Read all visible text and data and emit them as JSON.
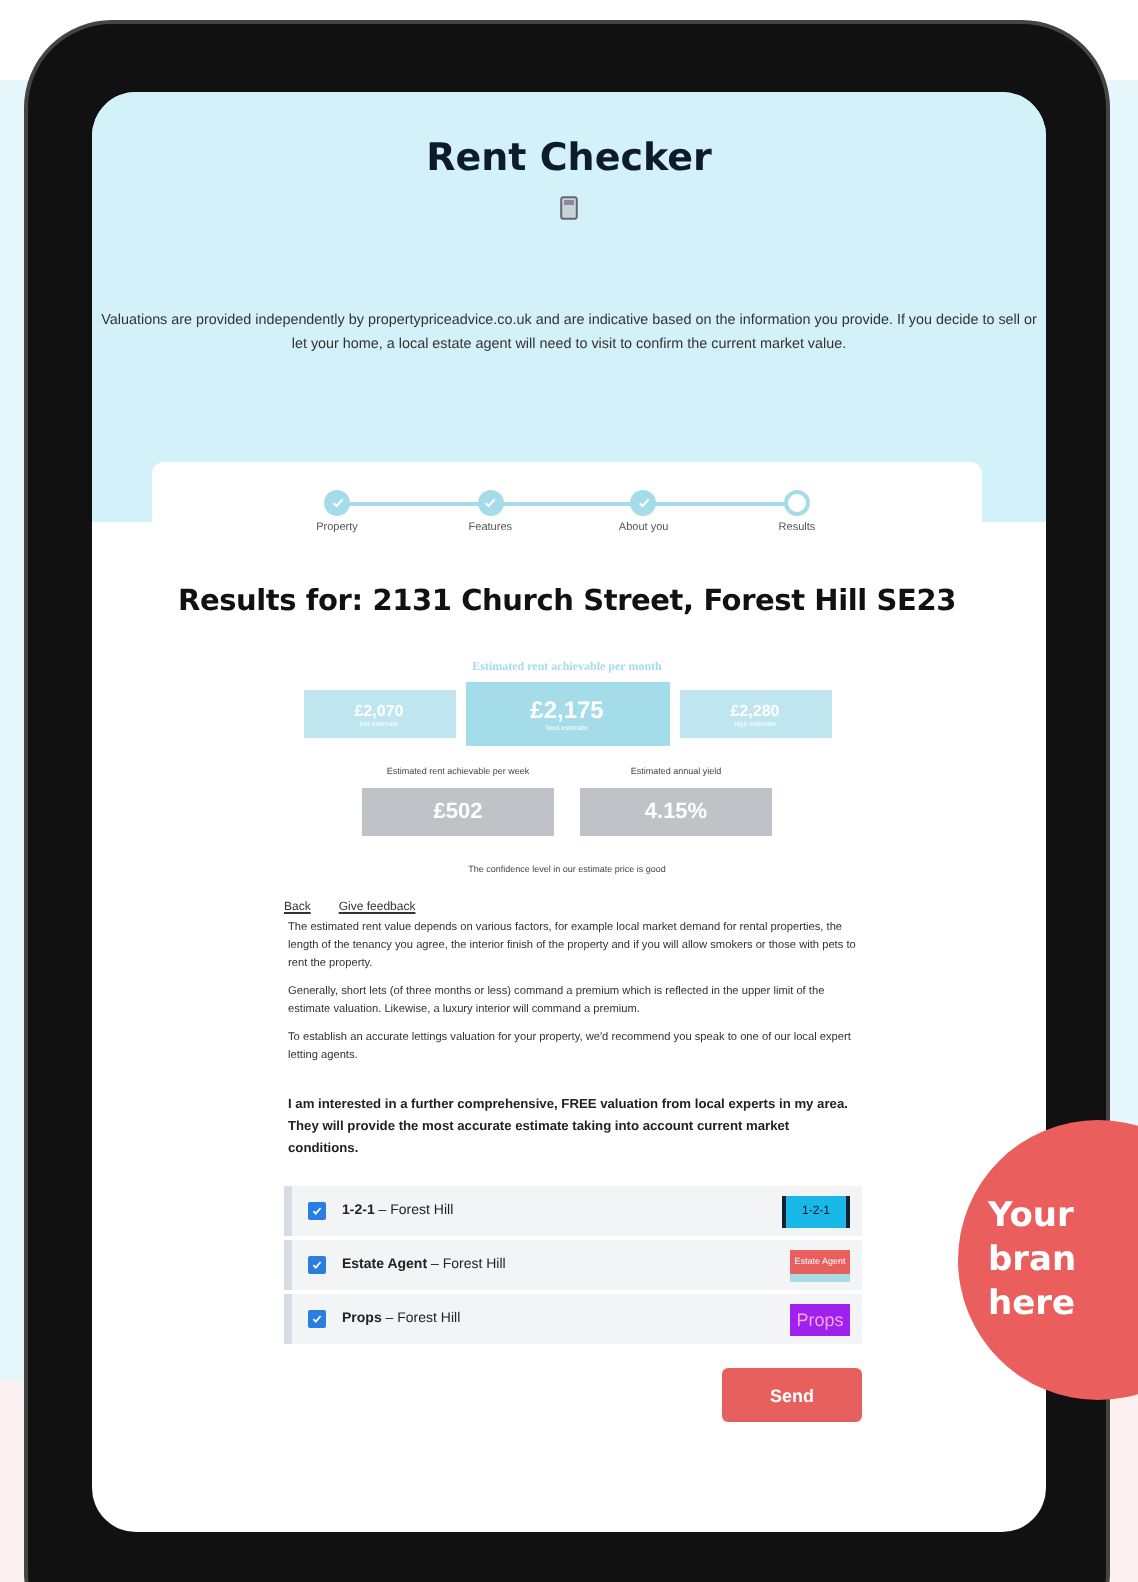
{
  "title": "Rent Checker",
  "disclaimer": "Valuations are provided independently by propertypriceadvice.co.uk and are indicative based on the information you provide. If you decide to sell or let your home, a local estate agent will need to visit to confirm the current market value.",
  "steps": [
    {
      "label": "Property",
      "done": true
    },
    {
      "label": "Features",
      "done": true
    },
    {
      "label": "About you",
      "done": true
    },
    {
      "label": "Results",
      "done": false
    }
  ],
  "results_heading": "Results for: 2131 Church Street, Forest Hill SE23",
  "monthly": {
    "label": "Estimated rent achievable per month",
    "estimates": [
      {
        "value": "£2,070",
        "caption": "low estimate",
        "featured": false
      },
      {
        "value": "£2,175",
        "caption": "best estimate",
        "featured": true
      },
      {
        "value": "£2,280",
        "caption": "high estimate",
        "featured": false
      }
    ]
  },
  "secondary": [
    {
      "label": "Estimated rent achievable per week",
      "value": "£502"
    },
    {
      "label": "Estimated annual yield",
      "value": "4.15%"
    }
  ],
  "confidence": "The confidence level in our estimate price is good",
  "links": [
    "Back",
    "Give feedback"
  ],
  "paragraphs": [
    "The estimated rent value depends on various factors, for example local market demand for rental properties, the length of the tenancy you agree, the interior finish of the property and if you will allow smokers or those with pets to rent the property.",
    "Generally, short lets (of three months or less) command a premium which is reflected in the upper limit of the estimate valuation. Likewise, a luxury interior will command a premium.",
    "To establish an accurate lettings valuation for your property, we'd recommend you speak to one of our local expert letting agents."
  ],
  "interest": "I am interested in a further comprehensive, FREE valuation from local experts in my area. They will provide the most accurate estimate taking into account current market conditions.",
  "agents": [
    {
      "checked": true,
      "label": "**1-2-1** – Forest Hill",
      "logo": "1-2-1",
      "color": "#1ab8e8"
    },
    {
      "checked": true,
      "label": "**Estate Agent** – Forest Hill",
      "logo": "Estate Agent",
      "color": "#e8605e"
    },
    {
      "checked": true,
      "label": "**Props** – Forest Hill",
      "logo": "Props",
      "color": "#a020f0"
    }
  ],
  "send": "Send",
  "badge": [
    "Your",
    "bran",
    "here"
  ]
}
